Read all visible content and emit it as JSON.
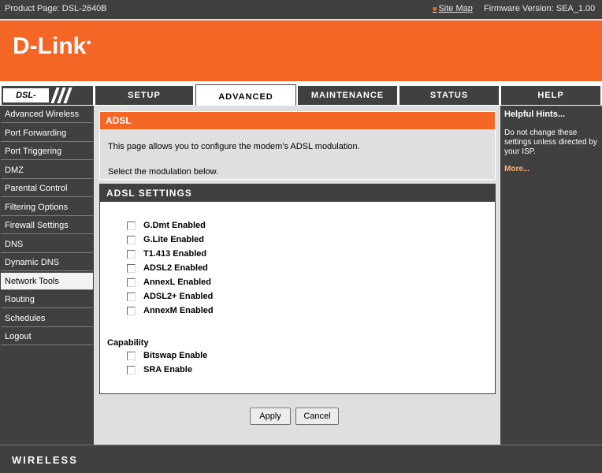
{
  "topbar": {
    "product": "Product Page: DSL-2640B",
    "site_map": "Site Map",
    "firmware": "Firmware Version: SEA_1.00"
  },
  "brand": {
    "logo": "D-Link",
    "color": "#f46625"
  },
  "model": {
    "label": "DSL-2640B"
  },
  "tabs": [
    {
      "label": "SETUP",
      "active": false
    },
    {
      "label": "ADVANCED",
      "active": true
    },
    {
      "label": "MAINTENANCE",
      "active": false
    },
    {
      "label": "STATUS",
      "active": false
    },
    {
      "label": "HELP",
      "active": false
    }
  ],
  "menu": [
    {
      "label": "Advanced Wireless"
    },
    {
      "label": "Port Forwarding"
    },
    {
      "label": "Port Triggering"
    },
    {
      "label": "DMZ"
    },
    {
      "label": "Parental Control"
    },
    {
      "label": "Filtering Options"
    },
    {
      "label": "Firewall Settings"
    },
    {
      "label": "DNS"
    },
    {
      "label": "Dynamic DNS"
    },
    {
      "label": "Network Tools",
      "active": true
    },
    {
      "label": "Routing"
    },
    {
      "label": "Schedules"
    },
    {
      "label": "Logout"
    }
  ],
  "adsl": {
    "title": "ADSL",
    "description": "This page allows you to configure the modem's ADSL modulation.",
    "instruction": "Select the modulation below."
  },
  "settings": {
    "title": "ADSL SETTINGS",
    "modulations": [
      {
        "label": "G.Dmt Enabled",
        "checked": false
      },
      {
        "label": "G.Lite Enabled",
        "checked": false
      },
      {
        "label": "T1.413 Enabled",
        "checked": false
      },
      {
        "label": "ADSL2 Enabled",
        "checked": false
      },
      {
        "label": "AnnexL Enabled",
        "checked": false
      },
      {
        "label": "ADSL2+ Enabled",
        "checked": false
      },
      {
        "label": "AnnexM Enabled",
        "checked": false
      }
    ],
    "capability_title": "Capability",
    "capabilities": [
      {
        "label": "Bitswap Enable",
        "checked": false
      },
      {
        "label": "SRA Enable",
        "checked": false
      }
    ]
  },
  "buttons": {
    "apply": "Apply",
    "cancel": "Cancel"
  },
  "hints": {
    "title": "Helpful Hints...",
    "body": "Do not change these settings unless directed by your ISP.",
    "more": "More..."
  },
  "footer": {
    "label": "WIRELESS"
  }
}
